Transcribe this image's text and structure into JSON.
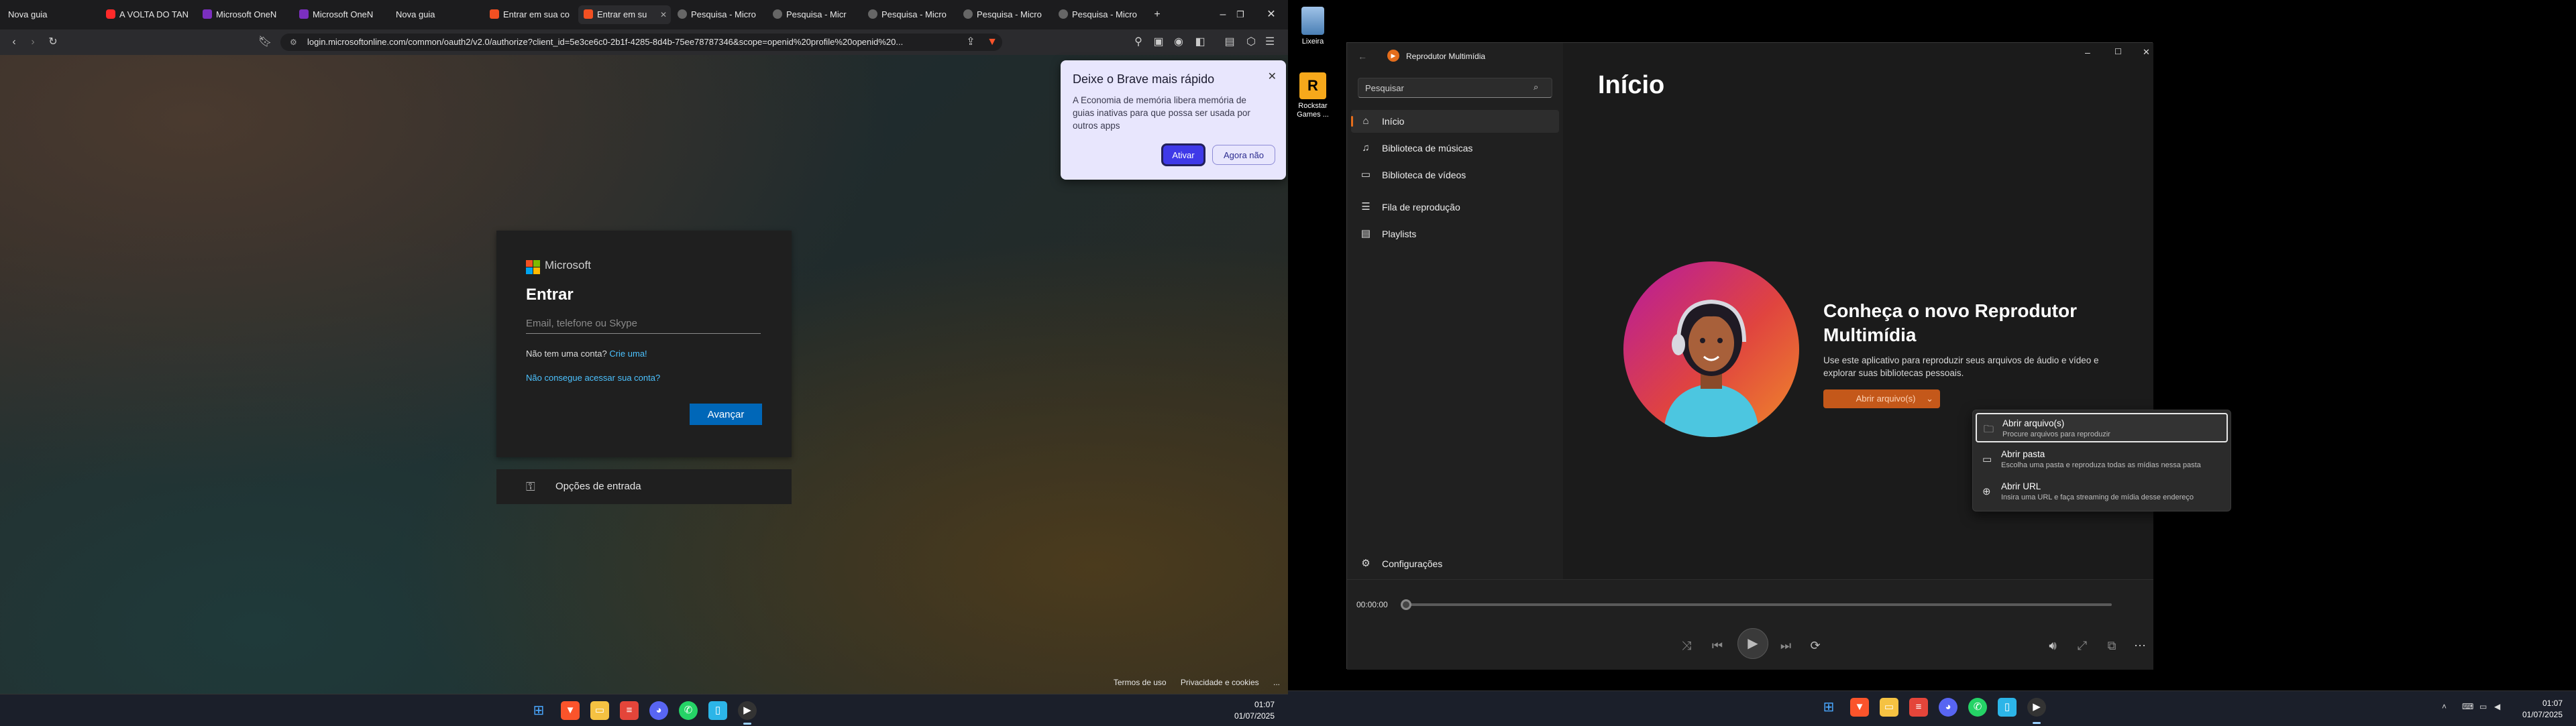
{
  "browser": {
    "tabs": [
      {
        "label": "Nova guia",
        "fav_color": ""
      },
      {
        "label": "A VOLTA DO TAN",
        "fav_color": "#ff2a2a"
      },
      {
        "label": "Microsoft OneN",
        "fav_color": "#7b2fbf"
      },
      {
        "label": "Microsoft OneN",
        "fav_color": "#7b2fbf"
      },
      {
        "label": "Nova guia",
        "fav_color": ""
      },
      {
        "label": "Entrar em sua co",
        "fav_color": "#f25022"
      },
      {
        "label": "Entrar em su",
        "fav_color": "#f25022"
      },
      {
        "label": "Pesquisa - Micro",
        "fav_color": "#888888"
      },
      {
        "label": "Pesquisa - Micr",
        "fav_color": "#888888"
      },
      {
        "label": "Pesquisa - Micro",
        "fav_color": "#888888"
      },
      {
        "label": "Pesquisa - Micro",
        "fav_color": "#888888"
      },
      {
        "label": "Pesquisa - Micro",
        "fav_color": "#888888"
      }
    ],
    "url": "login.microsoftonline.com/common/oauth2/v2.0/authorize?client_id=5e3ce6c0-2b1f-4285-8d4b-75ee78787346&scope=openid%20profile%20openid%20..."
  },
  "signin": {
    "brand": "Microsoft",
    "title": "Entrar",
    "email_placeholder": "Email, telefone ou Skype",
    "no_account": "Não tem uma conta?",
    "create_link": "Crie uma!",
    "cant_access": "Não consegue acessar sua conta?",
    "next": "Avançar",
    "options": "Opções de entrada",
    "footer_terms": "Termos de uso",
    "footer_privacy": "Privacidade e cookies",
    "footer_more": "..."
  },
  "brave_popup": {
    "title": "Deixe o Brave mais rápido",
    "body": "A Economia de memória libera memória de guias inativas para que possa ser usada por outros apps",
    "enable": "Ativar",
    "later": "Agora não"
  },
  "desktop": {
    "icons": [
      {
        "label": "Lixeira"
      },
      {
        "label": "Rockstar Games ..."
      }
    ]
  },
  "player": {
    "app_title": "Reprodutor Multimídia",
    "search_placeholder": "Pesquisar",
    "nav": [
      {
        "label": "Início",
        "icon": "home-icon"
      },
      {
        "label": "Biblioteca de músicas",
        "icon": "music-icon"
      },
      {
        "label": "Biblioteca de vídeos",
        "icon": "video-icon"
      },
      {
        "label": "Fila de reprodução",
        "icon": "queue-icon"
      },
      {
        "label": "Playlists",
        "icon": "playlist-icon"
      }
    ],
    "settings": "Configurações",
    "heading": "Início",
    "hero_title": "Conheça o novo Reprodutor Multimídia",
    "hero_desc": "Use este aplicativo para reproduzir seus arquivos de áudio e vídeo e explorar suas bibliotecas pessoais.",
    "open_button": "Abrir arquivo(s)",
    "menu": [
      {
        "title": "Abrir arquivo(s)",
        "sub": "Procure arquivos para reproduzir"
      },
      {
        "title": "Abrir pasta",
        "sub": "Escolha uma pasta e reproduza todas as mídias nessa pasta"
      },
      {
        "title": "Abrir URL",
        "sub": "Insira uma URL e faça streaming de mídia desse endereço"
      }
    ],
    "time": "00:00:00",
    "accent": "#e46d1c"
  },
  "taskbar": {
    "time": "01:07",
    "date": "01/07/2025"
  }
}
